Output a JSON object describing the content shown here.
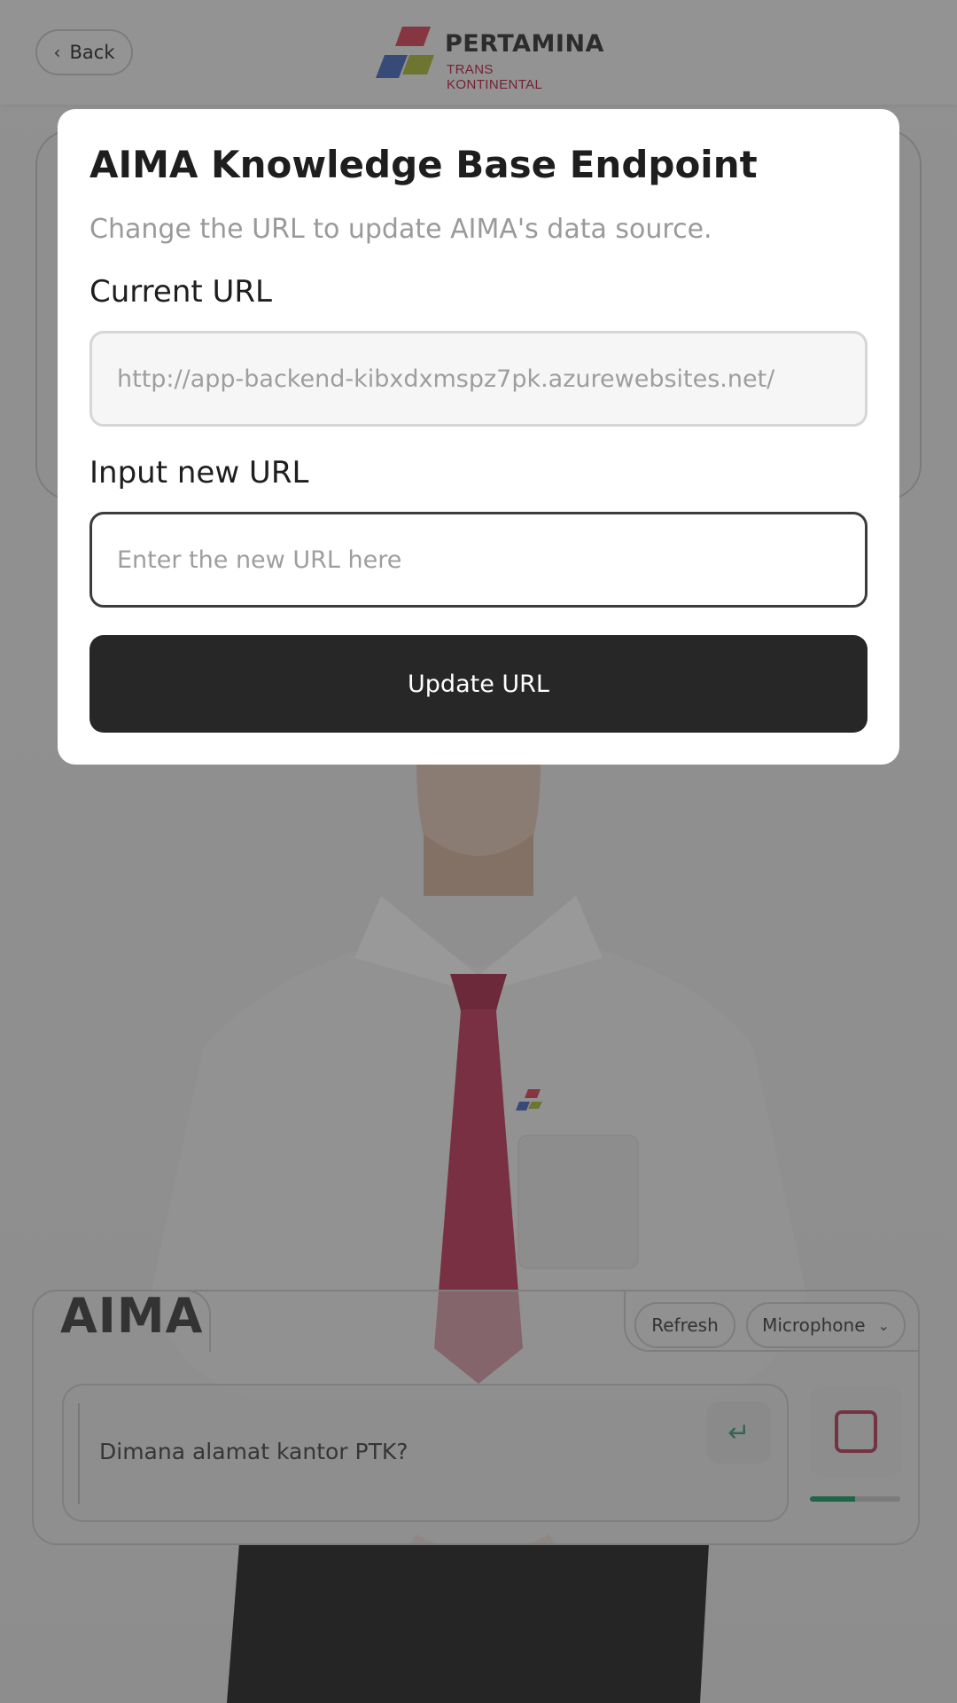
{
  "header": {
    "back_label": "Back",
    "back_icon": "chevron-left-icon",
    "logo": {
      "title": "PERTAMINA",
      "subtitle": "TRANS KONTINENTAL"
    }
  },
  "modal": {
    "title": "AIMA Knowledge Base Endpoint",
    "subtitle": "Change the URL to update AIMA's data source.",
    "current_label": "Current URL",
    "current_value": "http://app-backend-kibxdxmspz7pk.azurewebsites.net/",
    "new_label": "Input new URL",
    "new_placeholder": "Enter the new URL here",
    "new_value": "",
    "submit_label": "Update URL"
  },
  "chat": {
    "assistant_name": "AIMA",
    "refresh_label": "Refresh",
    "mic_select_value": "Microphone",
    "message_text": "Dimana alamat kantor PTK?",
    "send_icon": "enter-return-icon",
    "stop_icon": "stop-square-icon",
    "audio_level": 0.5
  },
  "colors": {
    "overlay": "rgba(0,0,0,0.40)",
    "button_dark": "#272727",
    "accent_red": "#c0395a",
    "accent_green": "#36a878"
  }
}
